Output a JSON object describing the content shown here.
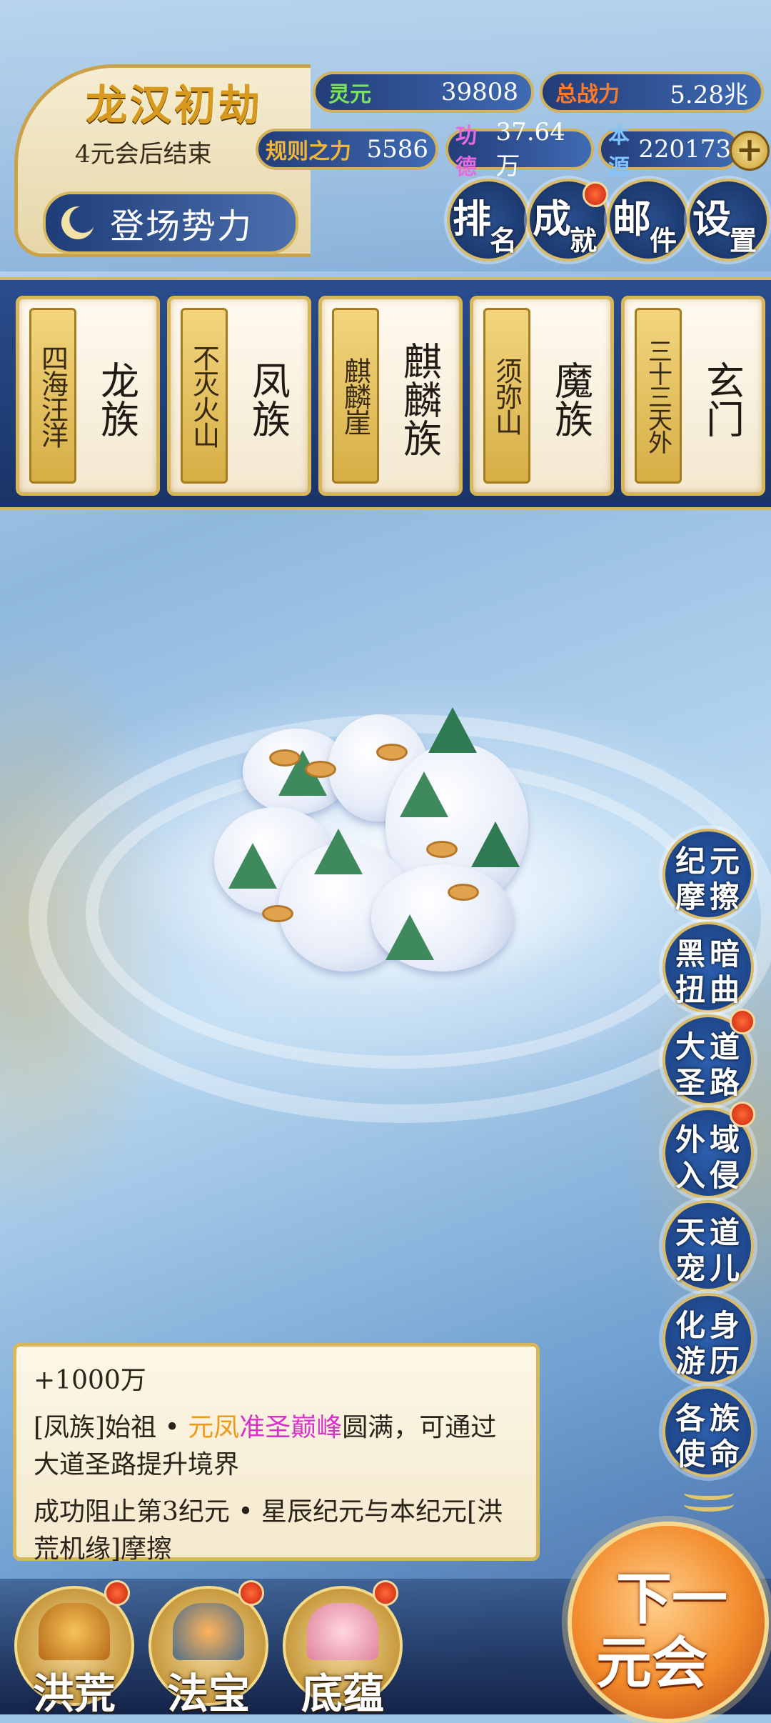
{
  "header": {
    "era_title": "龙汉初劫",
    "era_subtitle": "4元会后结束",
    "factions_button": "登场势力",
    "resources": {
      "lingyuan": {
        "label": "灵元",
        "value": "39808"
      },
      "total_power": {
        "label": "总战力",
        "value": "5.28兆"
      },
      "rule_power": {
        "label": "规则之力",
        "value": "5586"
      },
      "merit": {
        "label": "功德",
        "value": "37.64万"
      },
      "source": {
        "label": "本源",
        "value": "220173"
      }
    },
    "top_buttons": [
      {
        "c1": "排",
        "c2": "名"
      },
      {
        "c1": "成",
        "c2": "就"
      },
      {
        "c1": "邮",
        "c2": "件"
      },
      {
        "c1": "设",
        "c2": "置"
      }
    ]
  },
  "factions": [
    {
      "place": "四海汪洋",
      "name": "龙族"
    },
    {
      "place": "不灭火山",
      "name": "凤族"
    },
    {
      "place": "麒麟崖",
      "name": "麒麟族"
    },
    {
      "place": "须弥山",
      "name": "魔族"
    },
    {
      "place": "三十三天外",
      "name": "玄门"
    }
  ],
  "side_buttons": [
    {
      "a": "纪",
      "b": "元",
      "c": "摩",
      "d": "擦"
    },
    {
      "a": "黑",
      "b": "暗",
      "c": "扭",
      "d": "曲"
    },
    {
      "a": "大",
      "b": "道",
      "c": "圣",
      "d": "路"
    },
    {
      "a": "外",
      "b": "域",
      "c": "入",
      "d": "侵"
    },
    {
      "a": "天",
      "b": "道",
      "c": "宠",
      "d": "儿"
    },
    {
      "a": "化",
      "b": "身",
      "c": "游",
      "d": "历"
    },
    {
      "a": "各",
      "b": "族",
      "c": "使",
      "d": "命"
    }
  ],
  "messages": {
    "line1": "+1000万",
    "line2_prefix": "[凤族]始祖 • ",
    "line2_name": "元凤",
    "line2_rank": "准圣巅峰",
    "line2_suffix": "圆满，可通过大道圣路提升境界",
    "line3": "成功阻止第3纪元 • 星辰纪元与本纪元[洪荒机缘]摩擦"
  },
  "bottom": {
    "btn1": "洪荒",
    "btn2": "法宝",
    "btn3": "底蕴",
    "next_l1": "下一",
    "next_l2": "元会"
  },
  "colors": {
    "lingyuan_label": "#7be35a",
    "power_label": "#ff7a28",
    "rule_label": "#f2b634",
    "merit_label": "#e66be2",
    "source_label": "#7fc2ff"
  }
}
